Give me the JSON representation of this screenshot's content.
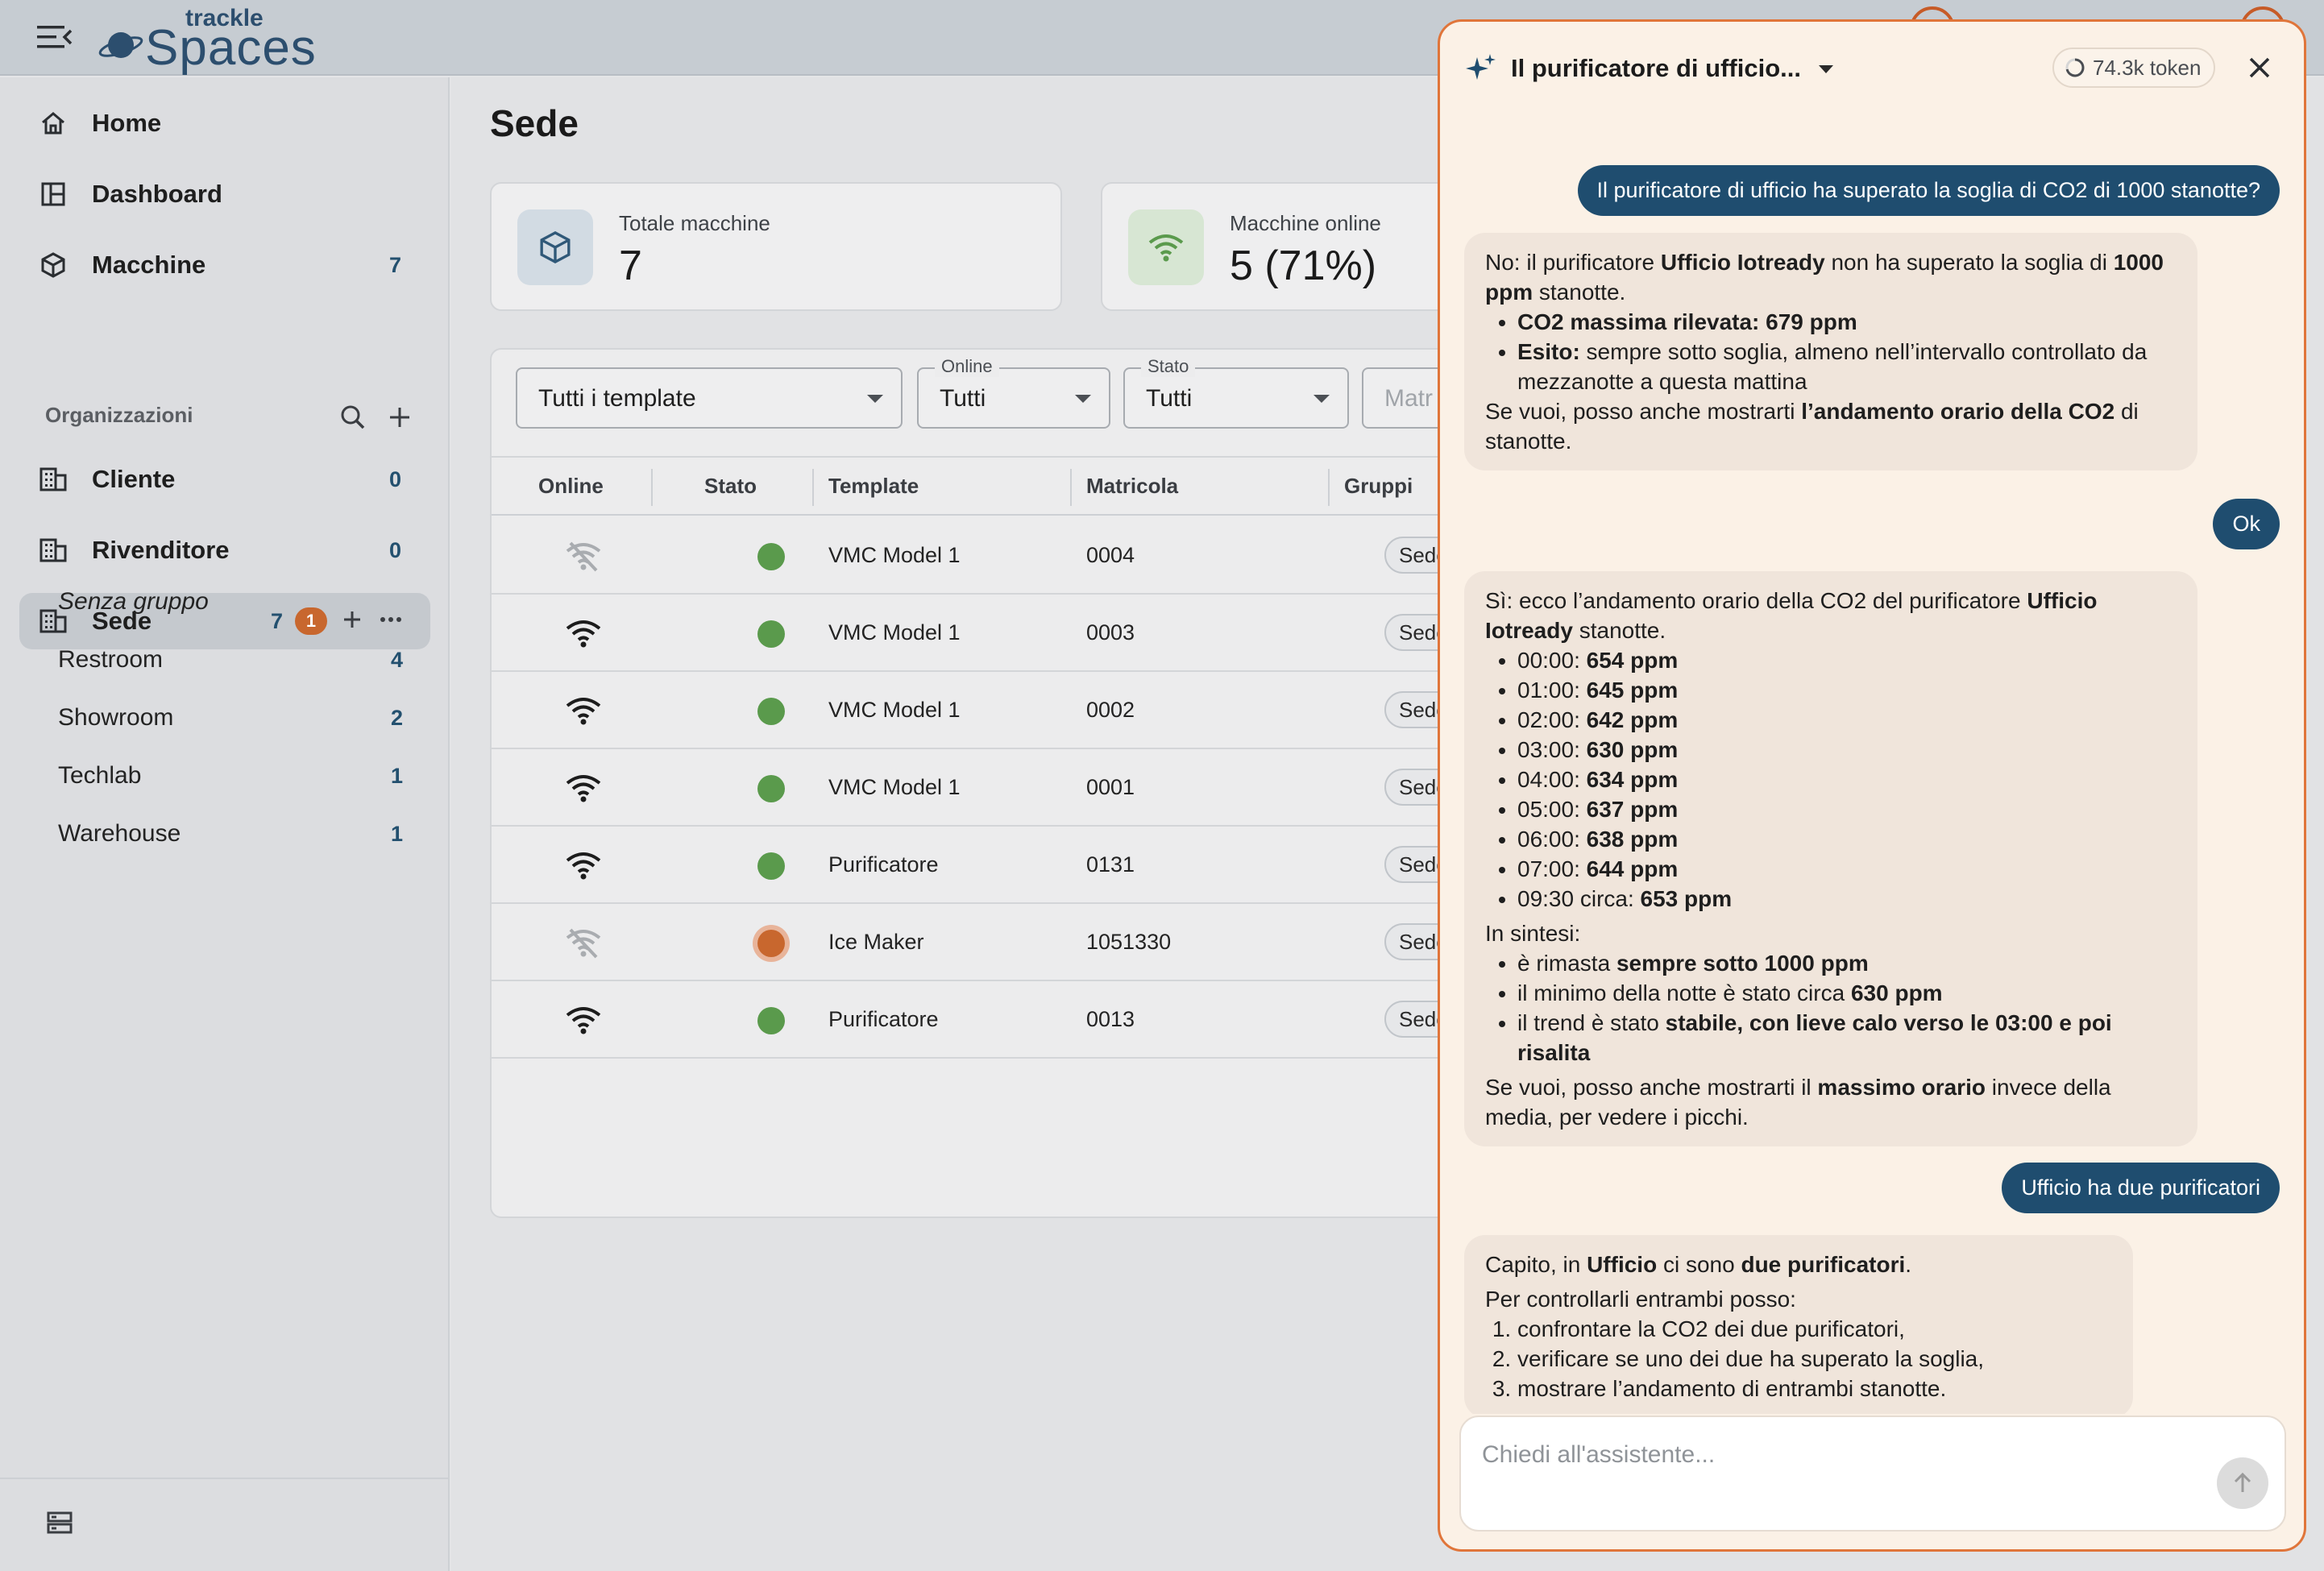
{
  "brand": {
    "logo_small": "trackle",
    "logo_big": "Spaces"
  },
  "sidebar": {
    "nav": [
      {
        "label": "Home",
        "count": ""
      },
      {
        "label": "Dashboard",
        "count": ""
      },
      {
        "label": "Macchine",
        "count": "7"
      }
    ],
    "section_label": "Organizzazioni",
    "orgs": [
      {
        "label": "Cliente",
        "count": "0"
      },
      {
        "label": "Rivenditore",
        "count": "0"
      },
      {
        "label": "Sede",
        "count": "7",
        "badge": "1"
      }
    ],
    "groups": [
      {
        "label": "Senza gruppo",
        "count": ""
      },
      {
        "label": "Restroom",
        "count": "4"
      },
      {
        "label": "Showroom",
        "count": "2"
      },
      {
        "label": "Techlab",
        "count": "1"
      },
      {
        "label": "Warehouse",
        "count": "1"
      }
    ]
  },
  "main": {
    "title": "Sede",
    "stats": [
      {
        "label": "Totale macchine",
        "value": "7"
      },
      {
        "label": "Macchine online",
        "value": "5 (71%)"
      }
    ],
    "filters": {
      "template": {
        "value": "Tutti i template"
      },
      "online": {
        "label": "Online",
        "value": "Tutti"
      },
      "stato": {
        "label": "Stato",
        "value": "Tutti"
      },
      "matricola_placeholder": "Matr"
    },
    "columns": [
      "Online",
      "Stato",
      "Template",
      "Matricola",
      "Gruppi"
    ],
    "rows": [
      {
        "online": false,
        "status": "green",
        "template": "VMC Model 1",
        "matricola": "0004",
        "gruppi": "Sede/Te"
      },
      {
        "online": true,
        "status": "green",
        "template": "VMC Model 1",
        "matricola": "0003",
        "gruppi": "Sede/Re"
      },
      {
        "online": true,
        "status": "green",
        "template": "VMC Model 1",
        "matricola": "0002",
        "gruppi": "Sede/Sh"
      },
      {
        "online": true,
        "status": "green",
        "template": "VMC Model 1",
        "matricola": "0001",
        "gruppi": "Sede/Sh"
      },
      {
        "online": true,
        "status": "green",
        "template": "Purificatore",
        "matricola": "0131",
        "gruppi": "Sede/Re"
      },
      {
        "online": false,
        "status": "orange",
        "template": "Ice Maker",
        "matricola": "1051330",
        "gruppi": "Sede/Re"
      },
      {
        "online": true,
        "status": "green",
        "template": "Purificatore",
        "matricola": "0013",
        "gruppi": "Sede/Re"
      }
    ]
  },
  "assistant": {
    "title": "Il purificatore di ufficio...",
    "tokens": "74.3k token",
    "input_placeholder": "Chiedi all'assistente...",
    "messages": {
      "u1": "Il purificatore di ufficio ha superato la soglia di CO2 di 1000 stanotte?",
      "b1": {
        "p1_a": "No: il purificatore ",
        "p1_b": "Ufficio Iotready",
        "p1_c": " non ha superato la soglia di ",
        "p1_d": "1000 ppm",
        "p1_e": " stanotte.",
        "li1_a": "CO2 massima rilevata: 679 ppm",
        "li2_a": "Esito:",
        "li2_b": " sempre sotto soglia, almeno nell’intervallo controllato da mezzanotte a questa mattina",
        "p2_a": "Se vuoi, posso anche mostrarti ",
        "p2_b": "l’andamento orario della CO2",
        "p2_c": " di stanotte."
      },
      "u2": "Ok",
      "b2": {
        "p1_a": "Sì: ecco l’andamento orario della CO2 del purificatore ",
        "p1_b": "Ufficio Iotready",
        "p1_c": " stanotte.",
        "hours": [
          {
            "t": "00:00: ",
            "v": "654 ppm"
          },
          {
            "t": "01:00: ",
            "v": "645 ppm"
          },
          {
            "t": "02:00: ",
            "v": "642 ppm"
          },
          {
            "t": "03:00: ",
            "v": "630 ppm"
          },
          {
            "t": "04:00: ",
            "v": "634 ppm"
          },
          {
            "t": "05:00: ",
            "v": "637 ppm"
          },
          {
            "t": "06:00: ",
            "v": "638 ppm"
          },
          {
            "t": "07:00: ",
            "v": "644 ppm"
          },
          {
            "t": "09:30 circa: ",
            "v": "653 ppm"
          }
        ],
        "sintesi": "In sintesi:",
        "s1_a": "è rimasta ",
        "s1_b": "sempre sotto 1000 ppm",
        "s2_a": "il minimo della notte è stato circa ",
        "s2_b": "630 ppm",
        "s3_a": "il trend è stato ",
        "s3_b": "stabile, con lieve calo verso le 03:00 e poi risalita",
        "p3_a": "Se vuoi, posso anche mostrarti il ",
        "p3_b": "massimo orario",
        "p3_c": " invece della media, per vedere i picchi."
      },
      "u3": "Ufficio ha due purificatori",
      "b3": {
        "p1_a": "Capito, in ",
        "p1_b": "Ufficio",
        "p1_c": " ci sono ",
        "p1_d": "due purificatori",
        "p1_e": ".",
        "p2": "Per controllarli entrambi posso:",
        "o1": "confrontare la CO2 dei due purificatori,",
        "o2": "verificare se uno dei due ha superato la soglia,",
        "o3": "mostrare l’andamento di entrambi stanotte."
      }
    }
  }
}
